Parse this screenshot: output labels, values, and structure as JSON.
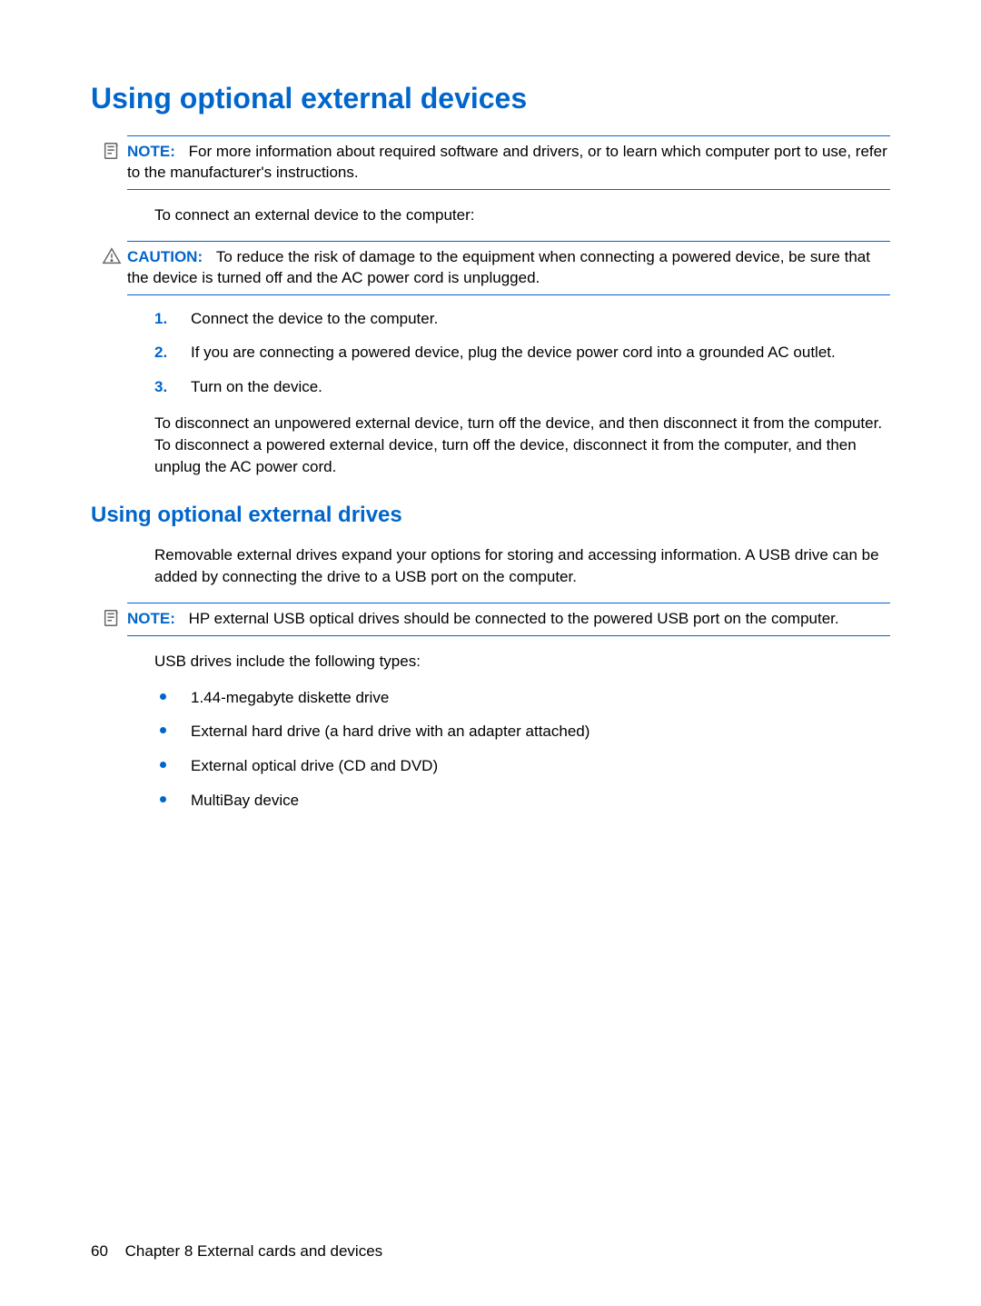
{
  "heading1": "Using optional external devices",
  "note1": {
    "label": "NOTE:",
    "text": "For more information about required software and drivers, or to learn which computer port to use, refer to the manufacturer's instructions."
  },
  "para_connect": "To connect an external device to the computer:",
  "caution1": {
    "label": "CAUTION:",
    "text": "To reduce the risk of damage to the equipment when connecting a powered device, be sure that the device is turned off and the AC power cord is unplugged."
  },
  "steps": [
    "Connect the device to the computer.",
    "If you are connecting a powered device, plug the device power cord into a grounded AC outlet.",
    "Turn on the device."
  ],
  "para_disconnect": "To disconnect an unpowered external device, turn off the device, and then disconnect it from the computer. To disconnect a powered external device, turn off the device, disconnect it from the computer, and then unplug the AC power cord.",
  "heading2": "Using optional external drives",
  "para_drives_intro": "Removable external drives expand your options for storing and accessing information. A USB drive can be added by connecting the drive to a USB port on the computer.",
  "note2": {
    "label": "NOTE:",
    "text": "HP external USB optical drives should be connected to the powered USB port on the computer."
  },
  "para_usb_types": "USB drives include the following types:",
  "bullets": [
    "1.44-megabyte diskette drive",
    "External hard drive (a hard drive with an adapter attached)",
    "External optical drive (CD and DVD)",
    "MultiBay device"
  ],
  "footer": {
    "page": "60",
    "chapter": "Chapter 8   External cards and devices"
  }
}
